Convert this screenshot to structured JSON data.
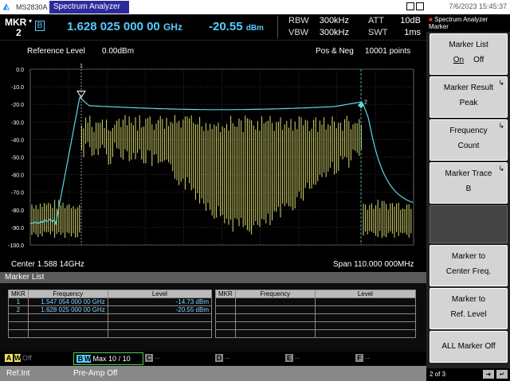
{
  "titlebar": {
    "model": "MS2830A",
    "tab": "Spectrum Analyzer",
    "datetime": "7/6/2023 15:45:37"
  },
  "header": {
    "mkr_label": "MKR",
    "mkr_num": "2",
    "trace_letter": "B",
    "frequency": "1.628 025 000 00",
    "frequency_unit": "GHz",
    "level": "-20.55",
    "level_unit": "dBm",
    "rbw_label": "RBW",
    "rbw_value": "300kHz",
    "vbw_label": "VBW",
    "vbw_value": "300kHz",
    "att_label": "ATT",
    "att_value": "10dB",
    "swt_label": "SWT",
    "swt_value": "1ms"
  },
  "plot": {
    "ref_label": "Reference Level",
    "ref_value": "0.00dBm",
    "detector": "Pos & Neg",
    "points": "10001 points",
    "center": "Center 1.588 14GHz",
    "span": "Span 110.000 000MHz",
    "y_ticks": [
      "0.0",
      "-10.0",
      "-20.0",
      "-30.0",
      "-40.0",
      "-50.0",
      "-60.0",
      "-70.0",
      "-80.0",
      "-90.0",
      "-100.0"
    ],
    "marker1_label": "1",
    "marker2_label": "2",
    "trace_colors": {
      "yellow": "#f0f07a",
      "cyan": "#5fd8e0"
    }
  },
  "marker_list": {
    "title": "Marker List",
    "headers": [
      "MKR",
      "Frequency",
      "Level"
    ],
    "rows": [
      {
        "mkr": "1",
        "freq": "1.547 054 000 00 GHz",
        "level": "-14.73 dBm"
      },
      {
        "mkr": "2",
        "freq": "1.628 025 000 00 GHz",
        "level": "-20.55 dBm"
      }
    ]
  },
  "traces": {
    "a_letter": "A",
    "a_extra": "W",
    "a_state": "Off",
    "b_letter": "B",
    "b_extra": "W",
    "b_mode": "Max",
    "b_count": "10",
    "b_total": "10",
    "c_letter": "C",
    "d_letter": "D",
    "e_letter": "E",
    "f_letter": "F",
    "dashes": "--"
  },
  "status": {
    "ref": "Ref.Int",
    "preamp": "Pre-Amp Off"
  },
  "side": {
    "app": "Spectrum Analyzer",
    "menu": "Marker",
    "keys": [
      {
        "line1": "Marker List",
        "on": "On",
        "off": "Off"
      },
      {
        "line1": "Marker Result",
        "line2": "Peak"
      },
      {
        "line1": "Frequency",
        "line2": "Count"
      },
      {
        "line1": "Marker Trace",
        "line2": "B"
      },
      {
        "line1": "Marker to",
        "line2": "Center Freq."
      },
      {
        "line1": "Marker to",
        "line2": "Ref. Level"
      },
      {
        "line1": "ALL Marker Off"
      }
    ],
    "page": "2 of 3"
  }
}
